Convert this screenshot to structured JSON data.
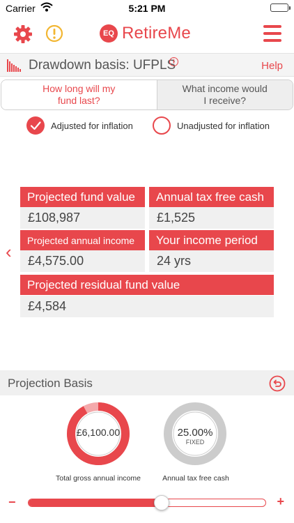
{
  "status_bar": {
    "carrier": "Carrier",
    "time": "5:21 PM"
  },
  "header": {
    "logo_badge": "EQ",
    "app_name": "RetireMe",
    "icons": [
      "gear-icon",
      "alert-icon",
      "hamburger-menu-icon"
    ]
  },
  "basis_bar": {
    "title": "Drawdown basis: UFPLS",
    "info_glyph": "i",
    "help": "Help"
  },
  "segment": {
    "option1": "How long will my fund last?",
    "option2": "What income would I receive?",
    "selected_index": 0
  },
  "inflation": {
    "adjusted_label": "Adjusted for inflation",
    "unadjusted_label": "Unadjusted for inflation",
    "selected": "adjusted"
  },
  "cards": {
    "fund_value": {
      "label": "Projected fund value",
      "value": "£108,987"
    },
    "tax_free_cash": {
      "label": "Annual tax free cash",
      "value": "£1,525"
    },
    "annual_income": {
      "label": "Projected annual income",
      "value": "£4,575.00"
    },
    "income_period": {
      "label": "Your income period",
      "value": "24 yrs"
    },
    "residual_value": {
      "label": "Projected residual fund value",
      "value": "£4,584"
    }
  },
  "nav": {
    "prev_glyph": "‹"
  },
  "projection": {
    "title": "Projection Basis",
    "gauges": [
      {
        "value": "£6,100.00",
        "sub": "",
        "caption": "Total gross annual income",
        "fill_fraction": 0.92
      },
      {
        "value": "25.00%",
        "sub": "FIXED",
        "caption": "Annual tax free cash",
        "fill_fraction": 0
      }
    ]
  },
  "slider": {
    "minus": "−",
    "plus": "+",
    "value_fraction": 0.56
  },
  "colors": {
    "accent": "#e8474c",
    "gauge_track_light": "#f4a9ab",
    "gauge_grey": "#cccccc",
    "alert_yellow": "#f2b632"
  }
}
